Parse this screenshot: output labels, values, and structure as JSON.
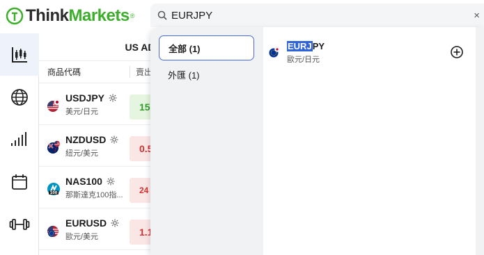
{
  "app": {
    "logo_think": "Think",
    "logo_markets": "Markets",
    "logo_reg": "®"
  },
  "rail": {
    "items": [
      "chart-candles-icon",
      "globe-icon",
      "signal-bars-icon",
      "calendar-icon",
      "dumbbell-icon"
    ]
  },
  "market_list": {
    "region_title": "US AD",
    "col_symbol": "商品代碼",
    "col_sell": "賣出",
    "rows": [
      {
        "symbol": "USDJPY",
        "desc": "美元/日元",
        "price": "15",
        "trend": "up",
        "flag": "us-jp"
      },
      {
        "symbol": "NZDUSD",
        "desc": "紐元/美元",
        "price": "0.5",
        "trend": "down",
        "flag": "nz-us"
      },
      {
        "symbol": "NAS100",
        "desc": "那斯達克100指...",
        "price": "24",
        "trend": "down",
        "flag": "nas"
      },
      {
        "symbol": "EURUSD",
        "desc": "歐元/美元",
        "price": "1.1",
        "trend": "down",
        "flag": "eu-us"
      }
    ]
  },
  "search": {
    "value": "EURJPY",
    "clear": "×"
  },
  "categories": [
    {
      "label": "全部 (1)",
      "active": true
    },
    {
      "label": "外匯 (1)",
      "active": false
    }
  ],
  "results": [
    {
      "symbol_highlight": "EURJ",
      "symbol_rest": "PY",
      "desc": "歐元/日元"
    }
  ],
  "colors": {
    "brand_green": "#3dae2b",
    "accent_blue": "#4a6bd6",
    "up_green": "#2fa02a",
    "down_red": "#d43131"
  }
}
